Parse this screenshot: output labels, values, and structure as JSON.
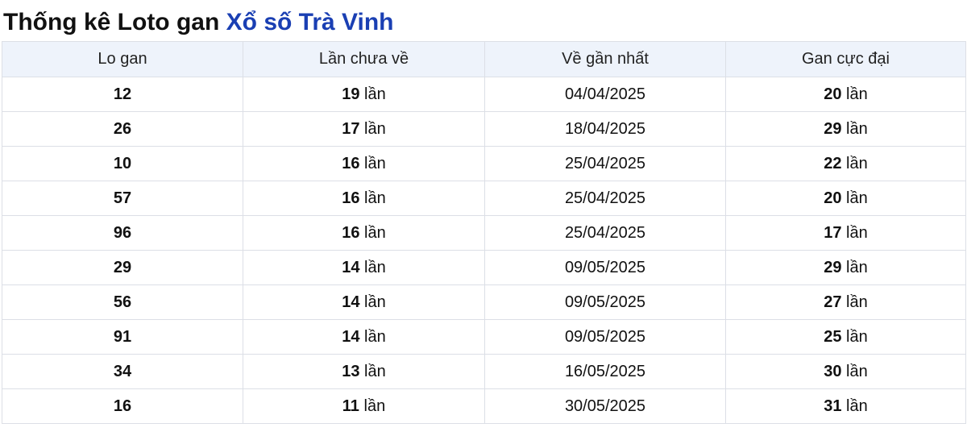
{
  "header": {
    "title_prefix": "Thống kê Loto gan",
    "title_accent": "Xổ số Trà Vinh"
  },
  "table": {
    "columns": [
      "Lo gan",
      "Lần chưa về",
      "Về gần nhất",
      "Gan cực đại"
    ],
    "unit": "lần",
    "rows": [
      {
        "lo": "12",
        "chua_ve": "19",
        "gan_nhat": "04/04/2025",
        "cuc_dai": "20"
      },
      {
        "lo": "26",
        "chua_ve": "17",
        "gan_nhat": "18/04/2025",
        "cuc_dai": "29"
      },
      {
        "lo": "10",
        "chua_ve": "16",
        "gan_nhat": "25/04/2025",
        "cuc_dai": "22"
      },
      {
        "lo": "57",
        "chua_ve": "16",
        "gan_nhat": "25/04/2025",
        "cuc_dai": "20"
      },
      {
        "lo": "96",
        "chua_ve": "16",
        "gan_nhat": "25/04/2025",
        "cuc_dai": "17"
      },
      {
        "lo": "29",
        "chua_ve": "14",
        "gan_nhat": "09/05/2025",
        "cuc_dai": "29"
      },
      {
        "lo": "56",
        "chua_ve": "14",
        "gan_nhat": "09/05/2025",
        "cuc_dai": "27"
      },
      {
        "lo": "91",
        "chua_ve": "14",
        "gan_nhat": "09/05/2025",
        "cuc_dai": "25"
      },
      {
        "lo": "34",
        "chua_ve": "13",
        "gan_nhat": "16/05/2025",
        "cuc_dai": "30"
      },
      {
        "lo": "16",
        "chua_ve": "11",
        "gan_nhat": "30/05/2025",
        "cuc_dai": "31"
      }
    ]
  },
  "colors": {
    "accent": "#1a3fb3",
    "header_bg": "#eef3fb",
    "border": "#dcdfe6"
  }
}
